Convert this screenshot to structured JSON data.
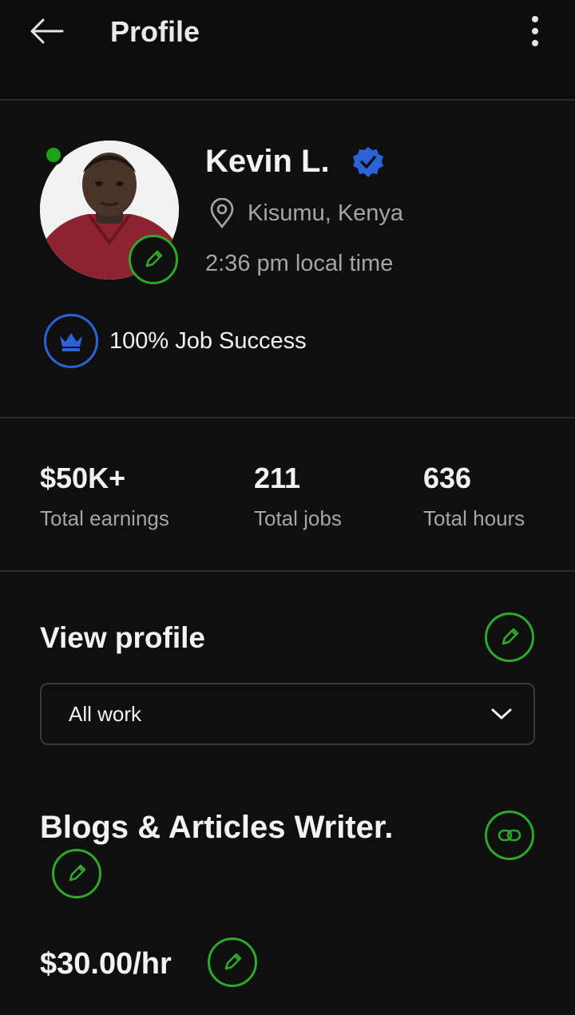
{
  "header": {
    "back_icon": "arrow-left-icon",
    "title": "Profile",
    "more_icon": "more-vertical-icon"
  },
  "profile": {
    "name": "Kevin L.",
    "verified_icon": "verified-badge-icon",
    "location": "Kisumu, Kenya",
    "location_icon": "location-pin-icon",
    "local_time": "2:36 pm local time",
    "online_status": "online",
    "job_success": "100% Job Success",
    "job_success_icon": "crown-icon"
  },
  "stats": [
    {
      "value": "$50K+",
      "label": "Total earnings"
    },
    {
      "value": "211",
      "label": "Total jobs"
    },
    {
      "value": "636",
      "label": "Total hours"
    }
  ],
  "view_profile": {
    "title": "View profile",
    "dropdown_value": "All work",
    "dropdown_icon": "chevron-down-icon"
  },
  "specialty": {
    "title": "Blogs & Articles Writer.",
    "link_icon": "link-icon",
    "rate": "$30.00/hr"
  },
  "colors": {
    "accent_green": "#2ea82a",
    "online_green": "#1da11b",
    "verified_blue": "#2a62d8",
    "background": "#0f0f0f",
    "muted_text": "#a5a5a5"
  }
}
